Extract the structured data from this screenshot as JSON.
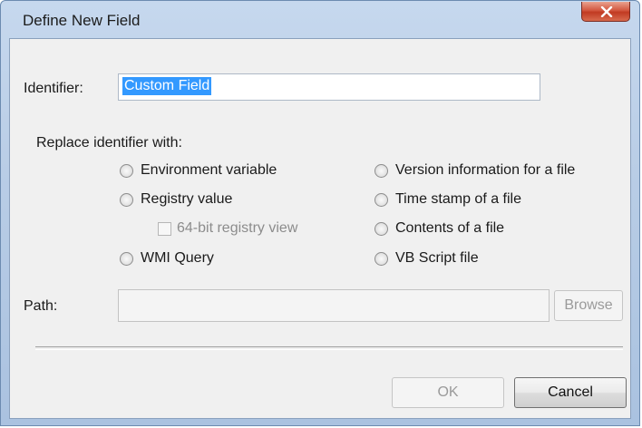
{
  "window": {
    "title": "Define New Field",
    "close_icon": "close-icon"
  },
  "identifier": {
    "label": "Identifier:",
    "value": "Custom Field"
  },
  "replace": {
    "label": "Replace identifier with:",
    "options_left": [
      {
        "label": "Environment variable",
        "selected": false
      },
      {
        "label": "Registry value",
        "selected": false
      },
      {
        "label": "WMI Query",
        "selected": false
      }
    ],
    "checkbox": {
      "label": "64-bit registry view",
      "checked": false,
      "enabled": false
    },
    "options_right": [
      {
        "label": "Version information for a file",
        "selected": false
      },
      {
        "label": "Time stamp of a file",
        "selected": false
      },
      {
        "label": "Contents of a file",
        "selected": false
      },
      {
        "label": "VB Script file",
        "selected": false
      }
    ]
  },
  "path": {
    "label": "Path:",
    "value": "",
    "browse_label": "Browse"
  },
  "buttons": {
    "ok_label": "OK",
    "cancel_label": "Cancel"
  },
  "colors": {
    "selection": "#3399ff",
    "close_button": "#c13a22",
    "title_bar": "#b9cde6"
  }
}
